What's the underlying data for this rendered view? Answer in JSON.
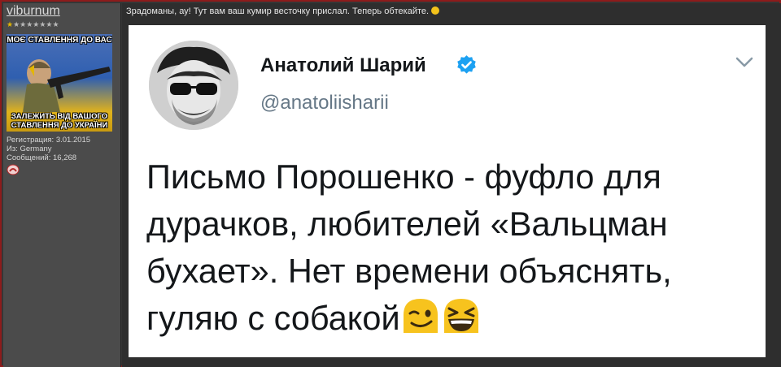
{
  "user": {
    "username": "viburnum",
    "stars": {
      "first": "★",
      "rest": "★★★★★★★"
    },
    "avatar": {
      "top_text": "МОЄ СТАВЛЕННЯ ДО ВАС",
      "bottom_text_1": "ЗАЛЕЖИТЬ ВІД ВАШОГО",
      "bottom_text_2": "СТАВЛЕННЯ ДО УКРАЇНИ"
    },
    "info": {
      "registration": "Регистрация: 3.01.2015",
      "from": "Из: Germany",
      "messages": "Сообщений: 16,268"
    },
    "rep_icon": "reputation-icon"
  },
  "post": {
    "text": "Зрадоманы, ау! Тут вам ваш кумир весточку прислал. Теперь обтекайте."
  },
  "tweet": {
    "name": "Анатолий Шарий",
    "handle": "@anatoliisharii",
    "line1": "Письмо Порошенко - фуфло для",
    "line2": "дурачков, любителей «Вальцман",
    "line3": "бухает». Нет времени объяснять,",
    "line4": "гуляю с собакой",
    "emojis": [
      "winking-face-icon",
      "grinning-squinting-face-icon"
    ],
    "colors": {
      "verified": "#1da1f2",
      "handle": "#657786",
      "text": "#14171a"
    }
  }
}
